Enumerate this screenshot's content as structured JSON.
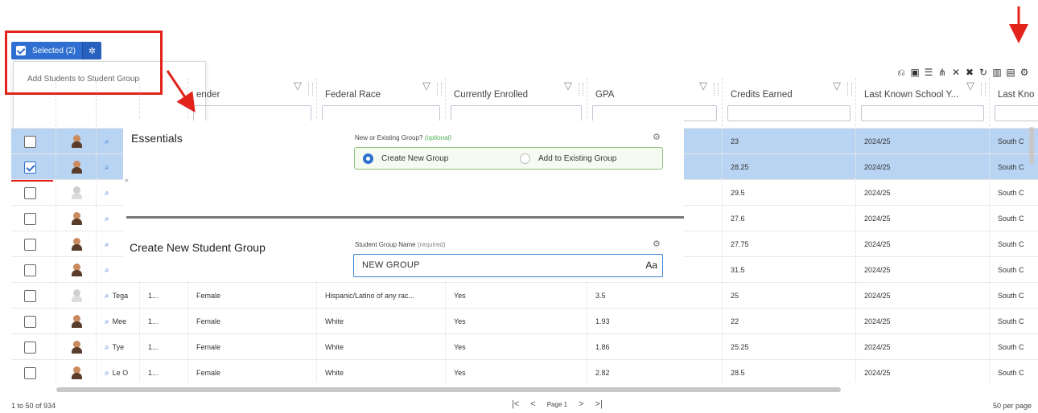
{
  "selected_button": {
    "label": "Selected (2)",
    "gear": "gear-icon"
  },
  "dropdown": {
    "item": "Add Students to Student Group"
  },
  "toolbar": {
    "icons": [
      "filter-reset-icon",
      "save-icon",
      "filter-list-icon",
      "share-icon",
      "expand-icon",
      "collapse-icon",
      "refresh-icon",
      "columns-icon",
      "export-icon",
      "settings-icon"
    ]
  },
  "columns": [
    {
      "label": "",
      "key": "check"
    },
    {
      "label": "",
      "key": "avatar"
    },
    {
      "label": "",
      "key": "name"
    },
    {
      "label": "",
      "key": "id"
    },
    {
      "label": "ender",
      "key": "gender"
    },
    {
      "label": "Federal Race",
      "key": "race"
    },
    {
      "label": "Currently Enrolled",
      "key": "enrolled"
    },
    {
      "label": "GPA",
      "key": "gpa"
    },
    {
      "label": "Credits Earned",
      "key": "credits"
    },
    {
      "label": "Last Known School Y...",
      "key": "year"
    },
    {
      "label": "Last Kno",
      "key": "school"
    }
  ],
  "rows": [
    {
      "checked": false,
      "selected": true,
      "name": "",
      "id": "",
      "gender": "",
      "race": "",
      "enrolled": "",
      "gpa": "",
      "credits": "23",
      "year": "2024/25",
      "school": "South C"
    },
    {
      "checked": true,
      "selected": true,
      "name": "",
      "id": "",
      "gender": "",
      "race": "",
      "enrolled": "",
      "gpa": "",
      "credits": "28.25",
      "year": "2024/25",
      "school": "South C"
    },
    {
      "checked": false,
      "selected": false,
      "ghost": true,
      "name": "",
      "id": "",
      "gender": "",
      "race": "",
      "enrolled": "",
      "gpa": "",
      "credits": "29.5",
      "year": "2024/25",
      "school": "South C"
    },
    {
      "checked": false,
      "selected": false,
      "name": "",
      "id": "",
      "gender": "",
      "race": "",
      "enrolled": "",
      "gpa": "",
      "credits": "27.6",
      "year": "2024/25",
      "school": "South C"
    },
    {
      "checked": false,
      "selected": false,
      "name": "",
      "id": "",
      "gender": "",
      "race": "",
      "enrolled": "",
      "gpa": "",
      "credits": "27.75",
      "year": "2024/25",
      "school": "South C"
    },
    {
      "checked": false,
      "selected": false,
      "name": "",
      "id": "",
      "gender": "",
      "race": "",
      "enrolled": "",
      "gpa": "",
      "credits": "31.5",
      "year": "2024/25",
      "school": "South C"
    },
    {
      "checked": false,
      "selected": false,
      "ghost": true,
      "name": "Tega",
      "id": "1...",
      "gender": "Female",
      "race": "Hispanic/Latino of any rac...",
      "enrolled": "Yes",
      "gpa": "3.5",
      "credits": "25",
      "year": "2024/25",
      "school": "South C"
    },
    {
      "checked": false,
      "selected": false,
      "name": "Mee",
      "id": "1...",
      "gender": "Female",
      "race": "White",
      "enrolled": "Yes",
      "gpa": "1.93",
      "credits": "22",
      "year": "2024/25",
      "school": "South C"
    },
    {
      "checked": false,
      "selected": false,
      "name": "Tye",
      "id": "1...",
      "gender": "Female",
      "race": "White",
      "enrolled": "Yes",
      "gpa": "1.86",
      "credits": "25.25",
      "year": "2024/25",
      "school": "South C"
    },
    {
      "checked": false,
      "selected": false,
      "name": "Le O",
      "id": "1...",
      "gender": "Female",
      "race": "White",
      "enrolled": "Yes",
      "gpa": "2.82",
      "credits": "28.5",
      "year": "2024/25",
      "school": "South C"
    }
  ],
  "overlay": {
    "essentials_title": "Essentials",
    "group_choice_label": "New or Existing Group?",
    "group_choice_hint": "(optional)",
    "option_new": "Create New Group",
    "option_existing": "Add to Existing Group",
    "create_title": "Create New Student Group",
    "name_label": "Student Group Name",
    "name_hint": "(required)",
    "name_value": "NEW GROUP",
    "name_icon": "Aa"
  },
  "footer": {
    "range": "1 to 50 of 934",
    "page": "Page 1",
    "per_page": "50 per page"
  },
  "colors": {
    "accent": "#2f6fd1",
    "highlight": "#e3231b",
    "row_selected": "#b8d4f2"
  }
}
